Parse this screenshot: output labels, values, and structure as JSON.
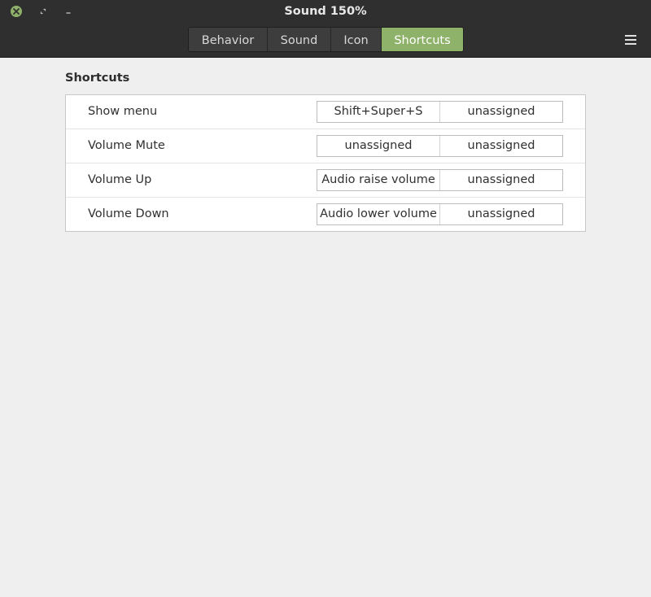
{
  "window": {
    "title": "Sound 150%",
    "controls": {
      "close": "close-icon",
      "maximize": "maximize-icon",
      "minimize": "minimize-icon"
    },
    "menu_icon": "hamburger-menu-icon"
  },
  "tabs": [
    {
      "label": "Behavior",
      "active": false
    },
    {
      "label": "Sound",
      "active": false
    },
    {
      "label": "Icon",
      "active": false
    },
    {
      "label": "Shortcuts",
      "active": true
    }
  ],
  "section": {
    "title": "Shortcuts"
  },
  "shortcuts": [
    {
      "label": "Show menu",
      "primary": "Shift+Super+S",
      "secondary": "unassigned"
    },
    {
      "label": "Volume Mute",
      "primary": "unassigned",
      "secondary": "unassigned"
    },
    {
      "label": "Volume Up",
      "primary": "Audio raise volume",
      "secondary": "unassigned"
    },
    {
      "label": "Volume Down",
      "primary": "Audio lower volume",
      "secondary": "unassigned"
    }
  ],
  "colors": {
    "accent": "#8fb26b",
    "titlebar": "#2f2f2f",
    "background": "#efefef"
  }
}
